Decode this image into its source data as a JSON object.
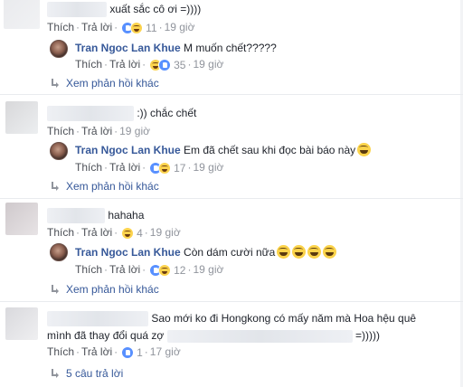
{
  "actions": {
    "like": "Thích",
    "reply": "Trả lời",
    "sep": "·"
  },
  "comments": [
    {
      "text": "xuất sắc cô ơi =))))",
      "reactions": "11",
      "time": "19 giờ",
      "reply": {
        "name": "Tran Ngoc Lan Khue",
        "text": "M muốn chết?????",
        "reactions": "35",
        "time": "19 giờ"
      },
      "more": "Xem phản hồi khác"
    },
    {
      "text": ":)) chắc chết",
      "time": "19 giờ",
      "reply": {
        "name": "Tran Ngoc Lan Khue",
        "text": "Em đã chết sau khi đọc bài báo này",
        "reactions": "17",
        "time": "19 giờ"
      },
      "more": "Xem phản hồi khác"
    },
    {
      "text": "hahaha",
      "reactions": "4",
      "time": "19 giờ",
      "reply": {
        "name": "Tran Ngoc Lan Khue",
        "text": "Còn dám cười nữa",
        "reactions": "12",
        "time": "19 giờ"
      },
      "more": "Xem phản hồi khác"
    },
    {
      "text_line1": "Sao mới ko đi Hongkong có mấy năm mà Hoa hệu quê",
      "text_line2_a": "mình đã thay đổi quá zợ",
      "text_line2_b": "=)))))",
      "reactions": "1",
      "time": "17 giờ",
      "more": "5 câu trả lời"
    }
  ]
}
